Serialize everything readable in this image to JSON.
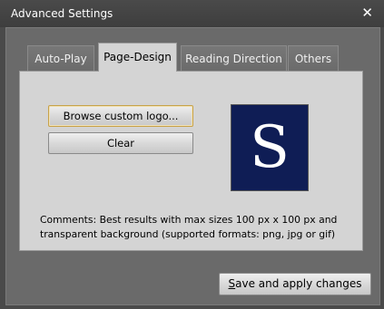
{
  "window": {
    "title": "Advanced Settings",
    "close_glyph": "✕"
  },
  "tabs": [
    {
      "label": "Auto-Play",
      "active": false
    },
    {
      "label": "Page-Design",
      "active": true
    },
    {
      "label": "Reading Direction",
      "active": false
    },
    {
      "label": "Others",
      "active": false
    }
  ],
  "page_design": {
    "browse_label": "Browse custom logo...",
    "clear_label": "Clear",
    "logo_letter": "S",
    "comments": "Comments: Best results with max sizes 100 px x 100 px and transparent background (supported formats: png, jpg or gif)"
  },
  "footer": {
    "save_first": "S",
    "save_rest": "ave and apply changes"
  },
  "colors": {
    "window_bg": "#4a4a4a",
    "client_bg": "#6a6a6a",
    "panel_bg": "#d4d4d4",
    "logo_bg": "#0f1d55",
    "focus_border": "#c7a24a"
  }
}
